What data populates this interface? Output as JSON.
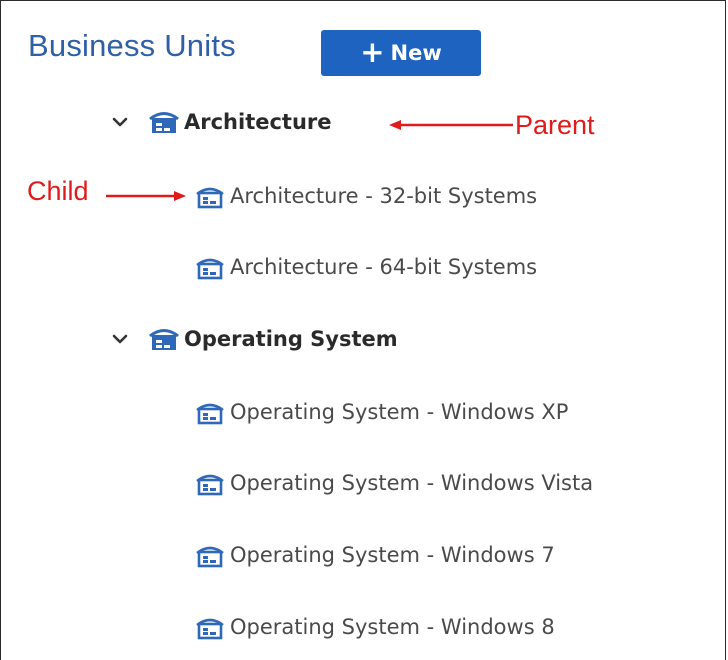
{
  "header": {
    "title": "Business Units",
    "new_button_label": "New"
  },
  "tree": {
    "groups": [
      {
        "label": "Architecture",
        "expanded": true,
        "children": [
          {
            "label": "Architecture - 32-bit Systems"
          },
          {
            "label": "Architecture - 64-bit Systems"
          }
        ]
      },
      {
        "label": "Operating System",
        "expanded": true,
        "children": [
          {
            "label": "Operating System - Windows XP"
          },
          {
            "label": "Operating System - Windows Vista"
          },
          {
            "label": "Operating System - Windows 7"
          },
          {
            "label": "Operating System - Windows 8"
          }
        ]
      }
    ]
  },
  "annotations": {
    "parent": "Parent",
    "child": "Child"
  },
  "colors": {
    "title": "#2f5fa7",
    "button": "#1e63c0",
    "icon": "#2f68b8",
    "annotation": "#e01b1b"
  },
  "icons": {
    "expand": "chevron-down-icon",
    "parent_unit": "business-unit-icon",
    "child_unit": "business-unit-child-icon",
    "add": "plus-icon"
  }
}
